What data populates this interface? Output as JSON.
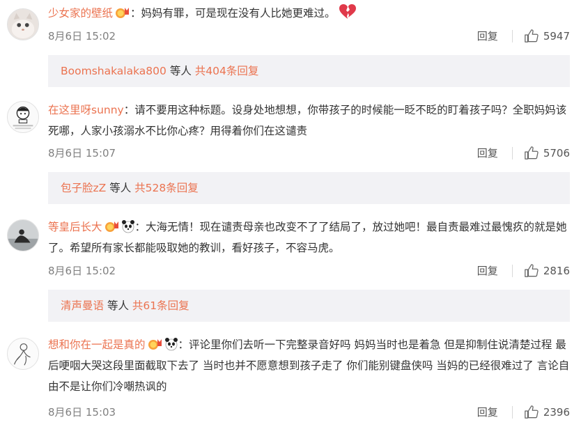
{
  "comments": [
    {
      "username": "少女家的壁纸",
      "content": "：妈妈有罪，可是现在没有人比她更难过。",
      "emoji": "broken-heart-icon",
      "time": "8月6日 15:02",
      "reply_label": "回复",
      "likes": "5947",
      "reply_summary": {
        "user": "Boomshakalaka800",
        "mid": " 等人 ",
        "count": "共404条回复"
      }
    },
    {
      "username": "在这里呀sunny",
      "content": "：请不要用这种标题。设身处地想想，你带孩子的时候能一眨不眨的盯着孩子吗？全职妈妈该死哪，人家小孩溺水不比你心疼？用得着你们在这谴责",
      "time": "8月6日 15:07",
      "reply_label": "回复",
      "likes": "5706",
      "reply_summary": {
        "user": "包子脸zZ",
        "mid": " 等人 ",
        "count": "共528条回复"
      }
    },
    {
      "username": "等皇后长大",
      "content": "：大海无情！现在谴责母亲也改变不了了结局了，放过她吧！最自责最难过最愧疚的就是她了。希望所有家长都能吸取她的教训，看好孩子，不容马虎。",
      "time": "8月6日 15:02",
      "reply_label": "回复",
      "likes": "2816",
      "reply_summary": {
        "user": "清声曼语",
        "mid": " 等人 ",
        "count": "共61条回复"
      }
    },
    {
      "username": "想和你在一起是真的",
      "content": "：评论里你们去听一下完整录音好吗 妈妈当时也是着急 但是抑制住说清楚过程 最后哽咽大哭这段里面截取下去了 当时也并不愿意想到孩子走了 你们能别键盘侠吗 当妈的已经很难过了 言论自由不是让你们冷嘲热讽的",
      "time": "8月6日 15:03",
      "reply_label": "回复",
      "likes": "2396"
    }
  ],
  "colors": {
    "username": "#eb7350",
    "meta": "#808080",
    "reply_bg": "#f2f2f5"
  }
}
